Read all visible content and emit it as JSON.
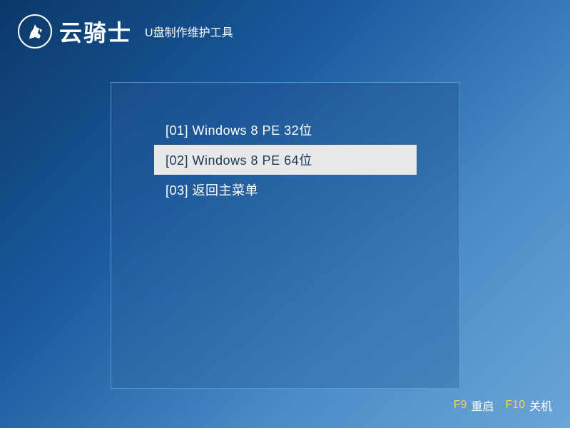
{
  "header": {
    "brand": "云骑士",
    "subtitle": "U盘制作维护工具"
  },
  "menu": {
    "items": [
      {
        "label": "[01] Windows 8 PE 32位",
        "selected": false
      },
      {
        "label": "[02] Windows 8 PE 64位",
        "selected": true
      },
      {
        "label": "[03] 返回主菜单",
        "selected": false
      }
    ]
  },
  "footer": {
    "hotkeys": [
      {
        "key": "F9",
        "label": "重启"
      },
      {
        "key": "F10",
        "label": "关机"
      }
    ]
  }
}
